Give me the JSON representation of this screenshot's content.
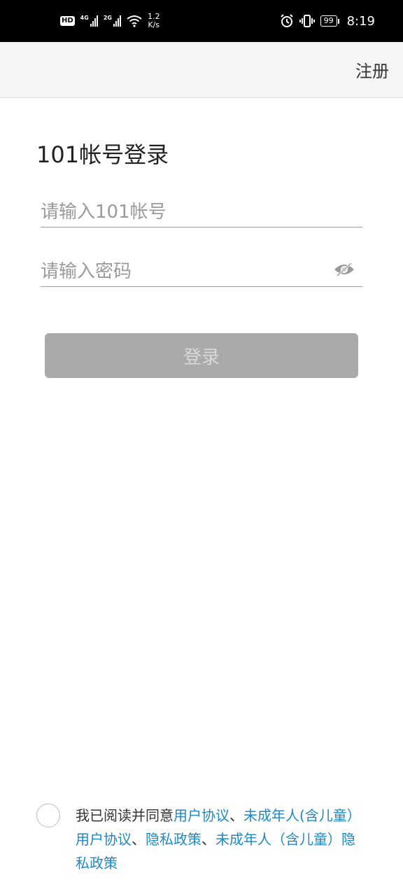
{
  "status_bar": {
    "hd_label": "HD",
    "net1_label": "4G",
    "net2_label": "2G",
    "speed_value": "1.2",
    "speed_unit": "K/s",
    "battery": "99",
    "time": "8:19"
  },
  "header": {
    "register_label": "注册"
  },
  "login": {
    "title": "101帐号登录",
    "account_placeholder": "请输入101帐号",
    "password_placeholder": "请输入密码",
    "login_label": "登录"
  },
  "agreement": {
    "prefix": "我已阅读并同意",
    "link1": "用户协议",
    "sep1": "、",
    "link2": "未成年人(含儿童）用户协议",
    "sep2": "、",
    "link3": "隐私政策",
    "sep3": "、",
    "link4": "未成年人（含儿童）隐私政策"
  },
  "colors": {
    "link": "#1e88c8",
    "button_disabled": "#aaaaaa"
  }
}
